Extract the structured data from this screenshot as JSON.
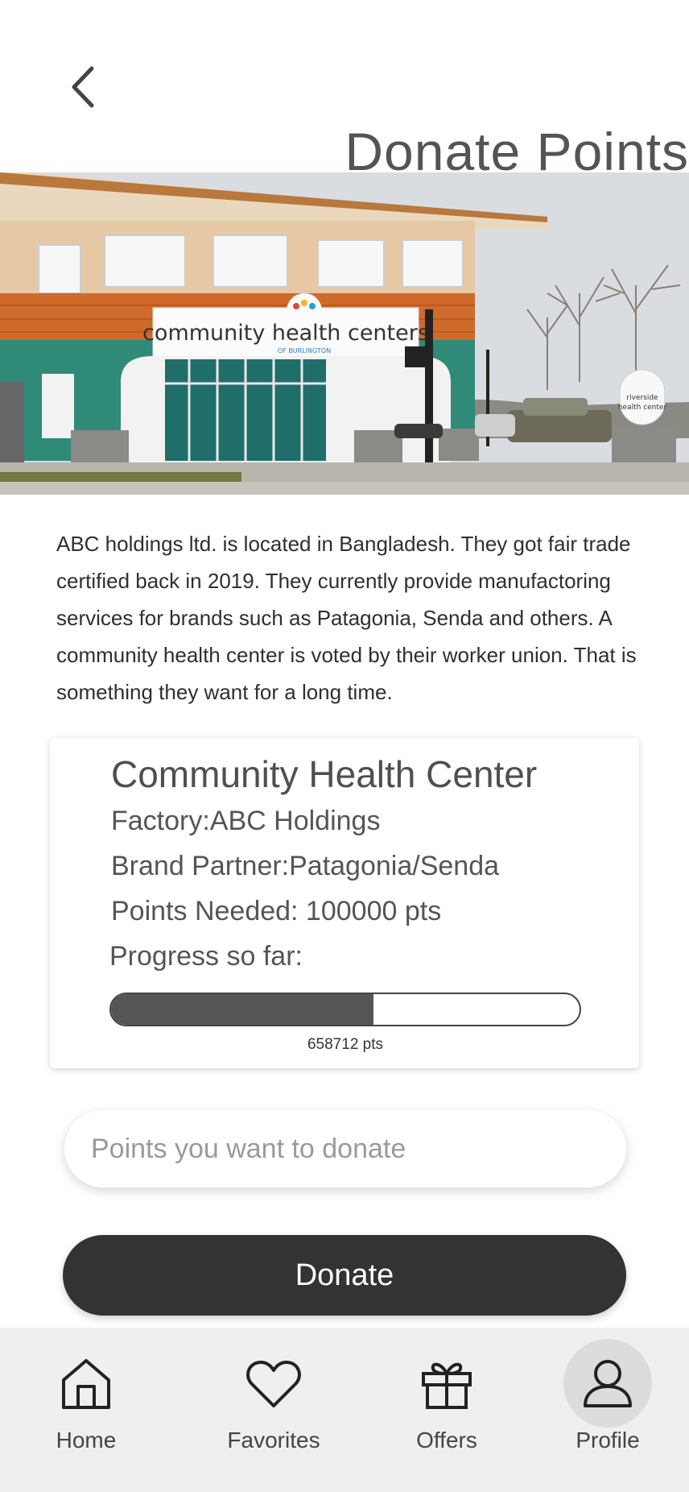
{
  "header": {
    "title": "Donate Points"
  },
  "description": "ABC holdings ltd. is located in Bangladesh. They got fair trade certified back in 2019. They currently provide manufactoring services for brands such as Patagonia, Senda and others. A community health center is voted by their worker union. That is something they want for a long time.",
  "hero": {
    "sign_text": "community health centers",
    "sign_subtext": "OF BURLINGTON",
    "small_sign_line1": "riverside",
    "small_sign_line2": "health center"
  },
  "project": {
    "name": "Community Health Center",
    "factory": "Factory:ABC Holdings",
    "brand_partner": "Brand Partner:Patagonia/Senda",
    "points_needed": "Points Needed: 100000 pts",
    "progress_label": "Progress so far:",
    "progress_fraction": 0.56,
    "progress_value": "658712 pts"
  },
  "donate": {
    "placeholder": "Points you want to donate",
    "button_label": "Donate"
  },
  "nav": {
    "items": [
      {
        "label": "Home",
        "icon": "home-icon",
        "active": false
      },
      {
        "label": "Favorites",
        "icon": "heart-icon",
        "active": false
      },
      {
        "label": "Offers",
        "icon": "gift-icon",
        "active": false
      },
      {
        "label": "Profile",
        "icon": "profile-icon",
        "active": true
      }
    ]
  },
  "colors": {
    "accent": "#333333",
    "nav_bg": "#efefef",
    "progress_fill": "#555555"
  }
}
